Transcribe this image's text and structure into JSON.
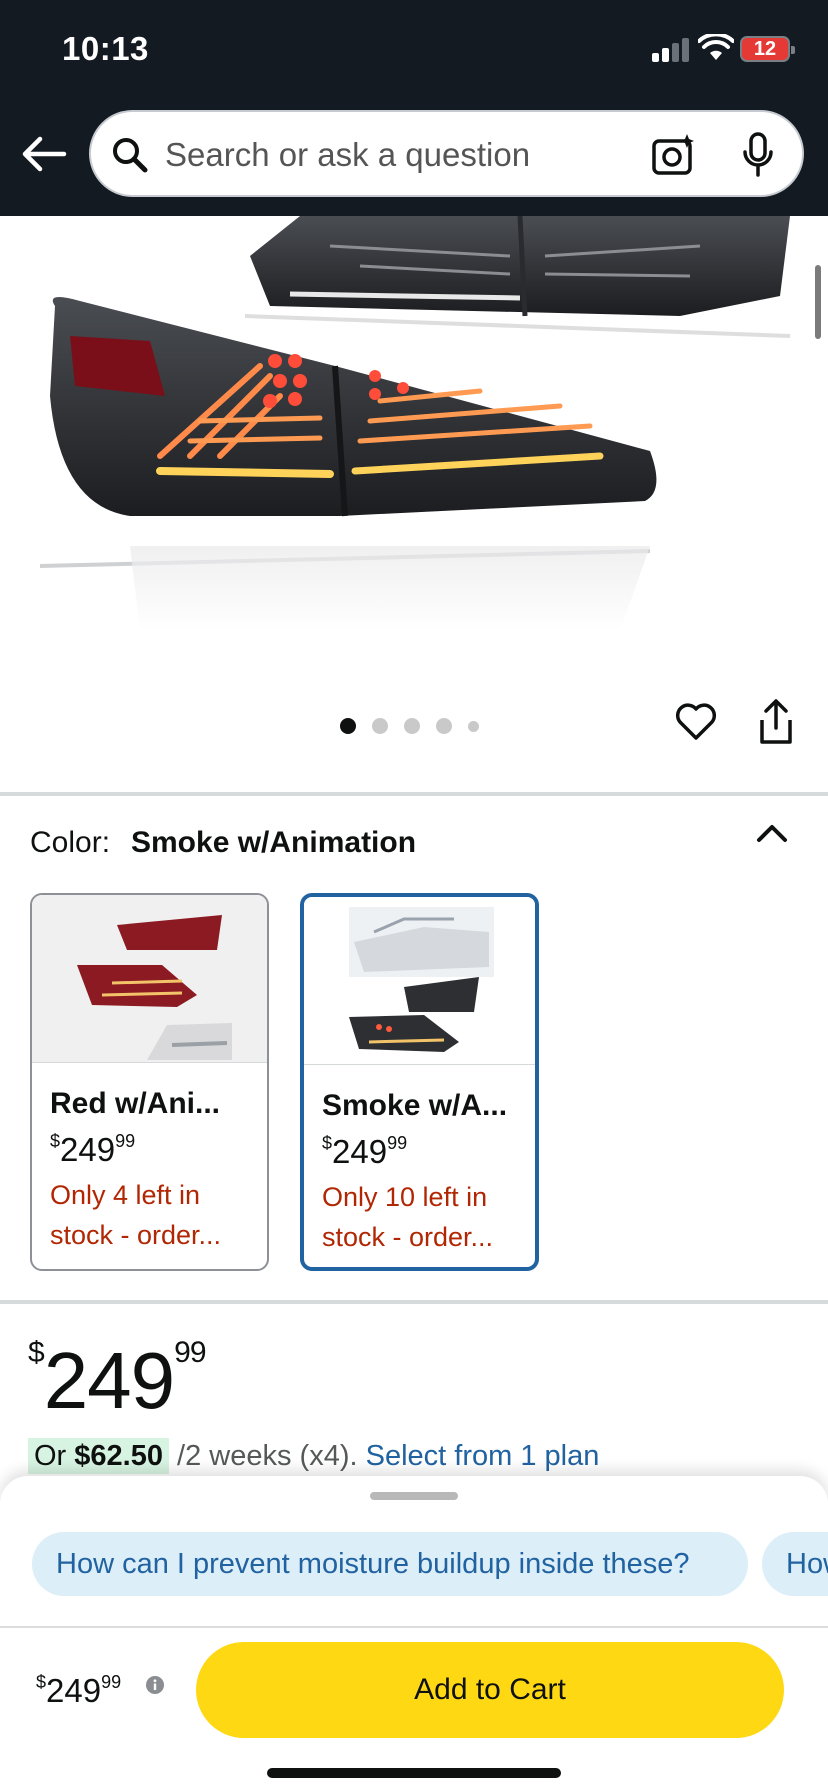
{
  "status": {
    "time": "10:13",
    "battery": "12"
  },
  "search": {
    "placeholder": "Search or ask a question"
  },
  "carousel": {
    "total_dots": 5,
    "active_index": 0
  },
  "color": {
    "label": "Color:",
    "selected_value": "Smoke w/Animation",
    "options": [
      {
        "name": "Red w/Ani...",
        "price_dollar": "$",
        "price_whole": "249",
        "price_cents": "99",
        "stock": "Only 4 left in stock - order..."
      },
      {
        "name": "Smoke w/A...",
        "price_dollar": "$",
        "price_whole": "249",
        "price_cents": "99",
        "stock": "Only 10 left in stock - order..."
      }
    ]
  },
  "price": {
    "currency": "$",
    "whole": "249",
    "cents": "99"
  },
  "plan": {
    "prefix": "Or",
    "amount": "$62.50",
    "suffix": "/2 weeks (x4).",
    "link": "Select from 1 plan"
  },
  "questions": [
    "How can I prevent moisture buildup inside these?",
    "How"
  ],
  "bottom_bar": {
    "currency": "$",
    "whole": "249",
    "cents": "99",
    "add_to_cart": "Add to Cart"
  },
  "colors": {
    "header_bg": "#131a22",
    "link": "#2162a1",
    "stock_red": "#b12704",
    "cart_yellow": "#ffd814",
    "selected_border": "#2162a1"
  }
}
